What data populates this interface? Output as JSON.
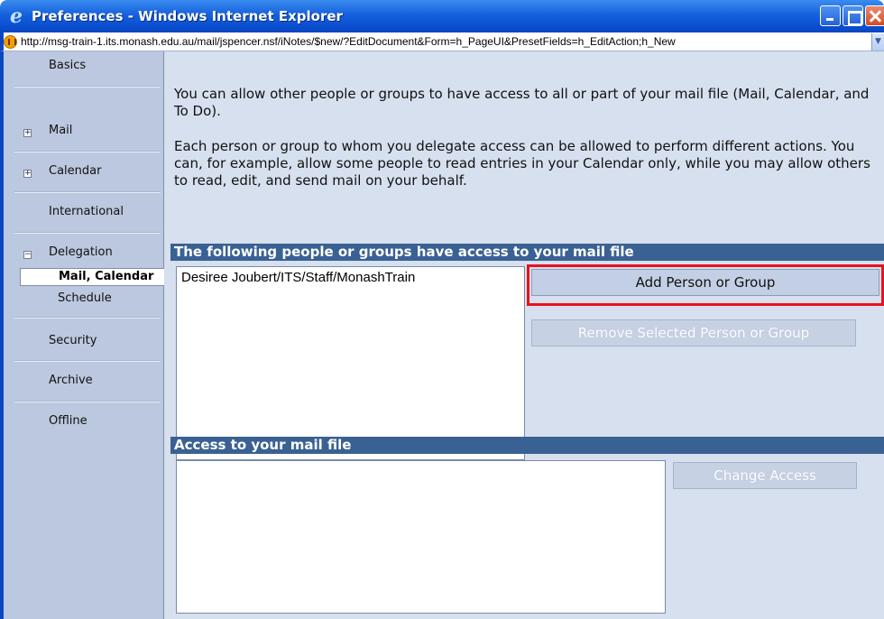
{
  "window": {
    "title": "Preferences - Windows Internet Explorer",
    "address": "http://msg-train-1.its.monash.edu.au/mail/jspencer.nsf/iNotes/$new/?EditDocument&Form=h_PageUI&PresetFields=h_EditAction;h_New"
  },
  "sidebar": {
    "basics": "Basics",
    "mail": "Mail",
    "calendar": "Calendar",
    "international": "International",
    "delegation": "Delegation",
    "mail_calendar": "Mail, Calendar",
    "schedule": "Schedule",
    "security": "Security",
    "archive": "Archive",
    "offline": "Offline",
    "expand_symbol": "+",
    "collapse_symbol": "−"
  },
  "main": {
    "intro1": "You can allow other people or groups to have access to all or part of your mail file (Mail, Calendar, and To Do).",
    "intro2": "Each person or group to whom you delegate access can be allowed to perform different actions. You can, for example, allow some people to read entries in your Calendar only, while you may allow others to read, edit, and send mail on your behalf.",
    "access_header": "The following people or groups have access to your mail file",
    "people": [
      "Desiree Joubert/ITS/Staff/MonashTrain"
    ],
    "add_button": "Add Person or Group",
    "remove_button": "Remove Selected Person or Group",
    "mailfile_header": "Access to your mail file",
    "change_button": "Change Access"
  }
}
